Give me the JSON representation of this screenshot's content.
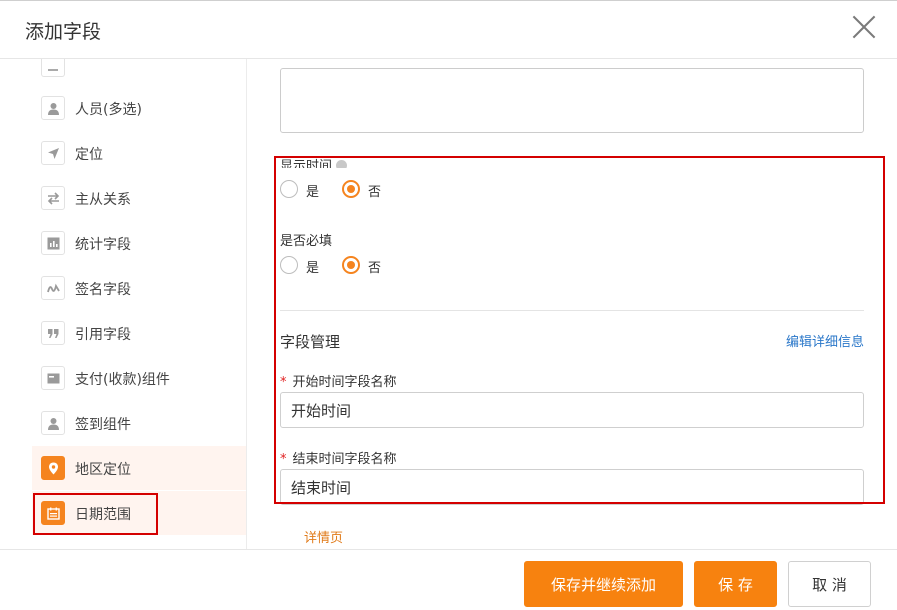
{
  "dialog": {
    "title": "添加字段"
  },
  "left_list": {
    "items": [
      {
        "label": "人员(多选)",
        "icon": "person-icon",
        "active": false
      },
      {
        "label": "定位",
        "icon": "location-arrow-icon",
        "active": false
      },
      {
        "label": "主从关系",
        "icon": "swap-arrows-icon",
        "active": false
      },
      {
        "label": "统计字段",
        "icon": "bar-chart-icon",
        "active": false
      },
      {
        "label": "签名字段",
        "icon": "signature-icon",
        "active": false
      },
      {
        "label": "引用字段",
        "icon": "quote-icon",
        "active": false
      },
      {
        "label": "支付(收款)组件",
        "icon": "payment-card-icon",
        "active": false
      },
      {
        "label": "签到组件",
        "icon": "checkin-person-icon",
        "active": false
      },
      {
        "label": "地区定位",
        "icon": "map-pin-icon",
        "active": true
      },
      {
        "label": "日期范围",
        "icon": "calendar-icon",
        "active": true
      }
    ]
  },
  "form": {
    "show_time": {
      "label": "显示时间",
      "options": [
        "是",
        "否"
      ],
      "selected": "否"
    },
    "required": {
      "label": "是否必填",
      "options": [
        "是",
        "否"
      ],
      "selected": "否"
    },
    "field_management": {
      "title": "字段管理",
      "edit_link": "编辑详细信息"
    },
    "start_field": {
      "label": "开始时间字段名称",
      "value": "开始时间",
      "required_mark": "*"
    },
    "end_field": {
      "label": "结束时间字段名称",
      "value": "结束时间",
      "required_mark": "*"
    },
    "peek_text": "详情页"
  },
  "footer": {
    "save_continue": "保存并继续添加",
    "save": "保 存",
    "cancel": "取 消"
  },
  "colors": {
    "accent": "#f7820f",
    "highlight_border": "#d40000",
    "link": "#2a77c9"
  }
}
